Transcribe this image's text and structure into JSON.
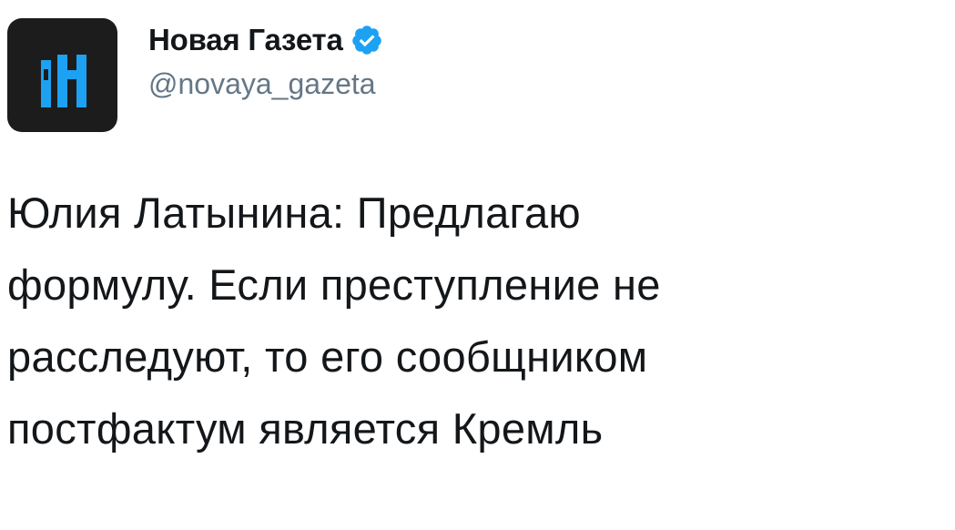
{
  "account": {
    "display_name": "Новая Газета",
    "handle": "@novaya_gazeta",
    "verified": true,
    "avatar_letter": "Н",
    "avatar_bg": "#1c1c1c",
    "avatar_accent": "#1da1f2",
    "verified_color": "#1da1f2"
  },
  "tweet": {
    "lines": [
      "Юлия Латынина: Предлагаю",
      "формулу. Если преступление не",
      "расследуют, то его сообщником",
      "постфактум является Кремль"
    ]
  },
  "icons": {
    "verified": "verified-badge-icon",
    "avatar": "novaya-gazeta-logo-icon"
  }
}
